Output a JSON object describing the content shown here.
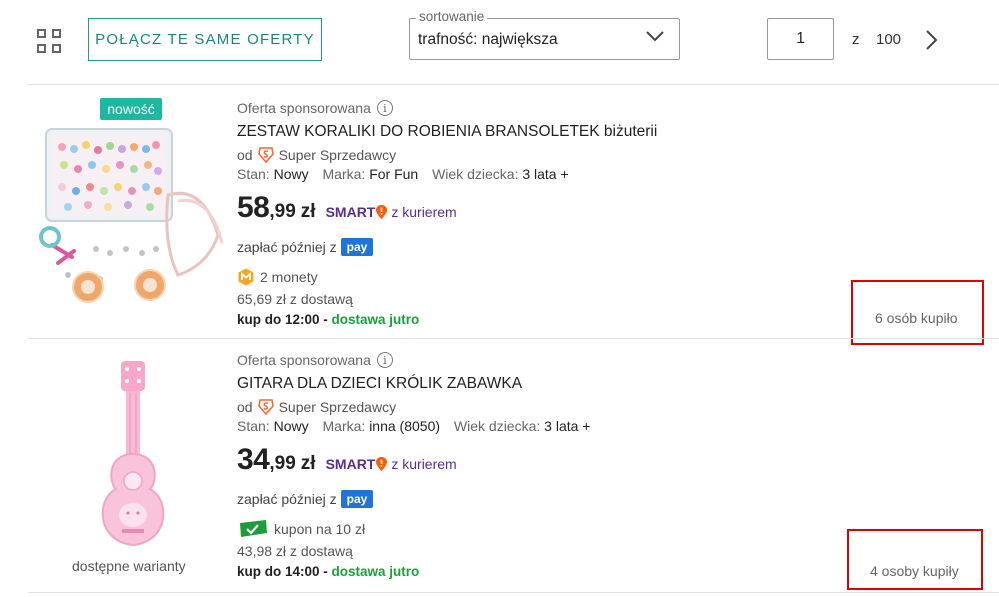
{
  "toolbar": {
    "merge_label": "POŁĄCZ TE SAME OFERTY",
    "sort_legend": "sortowanie",
    "sort_value": "trafność: największa",
    "page_current": "1",
    "page_of": "z",
    "page_total": "100"
  },
  "listings": [
    {
      "badge": "nowość",
      "sponsored": "Oferta sponsorowana",
      "title": "ZESTAW KORALIKI DO ROBIENIA BRANSOLETEK biżuterii",
      "seller_prefix": "od",
      "seller": "Super Sprzedawcy",
      "condition_label": "Stan:",
      "condition": "Nowy",
      "brand_label": "Marka:",
      "brand": "For Fun",
      "age_label": "Wiek dziecka:",
      "age": "3 lata +",
      "price_int": "58",
      "price_dec": ",99",
      "currency": "zł",
      "smart_label": "SMART",
      "smart_text": "z kurierem",
      "pay_later": "zapłać później z",
      "pay_logo": "pay",
      "perk": "2 monety",
      "perk_icon": "coin-icon",
      "delivery": "65,69 zł z dostawą",
      "deadline": "kup do 12:00 -",
      "delivery_when": "dostawa jutro",
      "bought": "6 osób kupiło"
    },
    {
      "variants": "dostępne warianty",
      "sponsored": "Oferta sponsorowana",
      "title": "GITARA DLA DZIECI KRÓLIK ZABAWKA",
      "seller_prefix": "od",
      "seller": "Super Sprzedawcy",
      "condition_label": "Stan:",
      "condition": "Nowy",
      "brand_label": "Marka:",
      "brand": "inna (8050)",
      "age_label": "Wiek dziecka:",
      "age": "3 lata +",
      "price_int": "34",
      "price_dec": ",99",
      "currency": "zł",
      "smart_label": "SMART",
      "smart_text": "z kurierem",
      "pay_later": "zapłać później z",
      "pay_logo": "pay",
      "perk": "kupon na 10 zł",
      "perk_icon": "coupon-icon",
      "delivery": "43,98 zł z dostawą",
      "deadline": "kup do 14:00 -",
      "delivery_when": "dostawa jutro",
      "bought": "4 osoby kupiły"
    }
  ],
  "colors": {
    "accent_teal": "#1d9b8e",
    "smart_purple": "#5a2d91",
    "delivery_green": "#1aa03a",
    "highlight_red": "#e00000",
    "pay_blue": "#1f73d9"
  }
}
